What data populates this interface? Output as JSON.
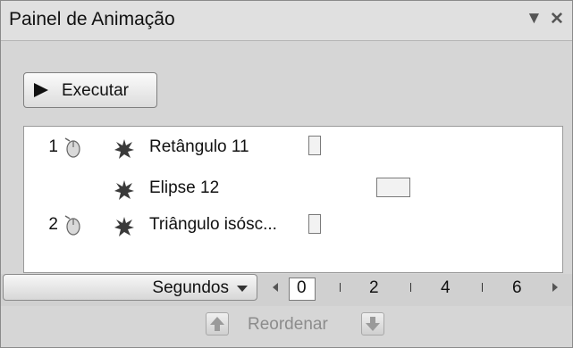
{
  "header": {
    "title": "Painel de Animação",
    "dropdown_icon": "chevron-down-icon",
    "close_icon": "close-icon"
  },
  "toolbar": {
    "play_label": "Executar",
    "play_icon": "play-icon"
  },
  "animation_list": [
    {
      "order": "1",
      "trigger_icon": "mouse-click-icon",
      "effect_icon": "effect-star-icon",
      "name": "Retângulo 11"
    },
    {
      "order": "",
      "trigger_icon": "",
      "effect_icon": "effect-star-icon",
      "name": "Elipse 12"
    },
    {
      "order": "2",
      "trigger_icon": "mouse-click-icon",
      "effect_icon": "effect-star-icon",
      "name": "Triângulo isósc..."
    }
  ],
  "timeline": {
    "unit_label": "Segundos",
    "scale": [
      "0",
      "2",
      "4",
      "6"
    ]
  },
  "reorder": {
    "label": "Reordenar",
    "up_icon": "arrow-up-icon",
    "down_icon": "arrow-down-icon"
  },
  "colors": {
    "panel_bg": "#d6d6d6",
    "list_bg": "#ffffff",
    "disabled_text": "#8c8c8c"
  }
}
